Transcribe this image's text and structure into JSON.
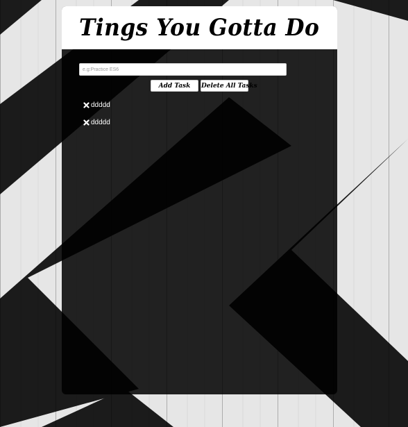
{
  "app": {
    "title": "Tings You Gotta Do"
  },
  "form": {
    "input_value": "",
    "input_placeholder": "e.g:Practice ES6",
    "add_label": "Add Task",
    "delete_all_label": "Delete All Tasks"
  },
  "tasks": [
    {
      "label": "ddddd",
      "icon": "close-icon"
    },
    {
      "label": "ddddd",
      "icon": "close-icon"
    }
  ],
  "colors": {
    "header_bg": "#ffffff",
    "panel_bg": "#000000",
    "text": "#ffffff"
  }
}
